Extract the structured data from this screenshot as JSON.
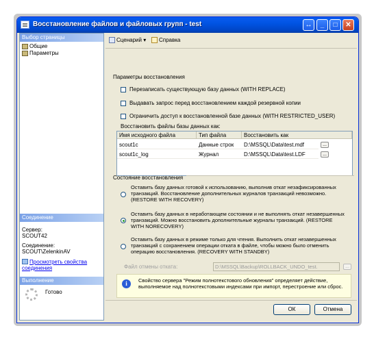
{
  "window": {
    "title": "Восстановление файлов и файловых групп - test"
  },
  "left_panel": {
    "select_page_header": "Выбор страницы",
    "pages": [
      {
        "label": "Общие"
      },
      {
        "label": "Параметры"
      }
    ],
    "connection_header": "Соединение",
    "server_label": "Сервер:",
    "server_value": "SCOUT42",
    "connection_label": "Соединение:",
    "connection_value": "SCOUT\\ZelenkinAV",
    "view_properties_link": "Просмотреть свойства соединения",
    "progress_header": "Выполнение",
    "progress_status": "Готово"
  },
  "toolbar": {
    "script_label": "Сценарий",
    "help_label": "Справка"
  },
  "restore_options": {
    "title": "Параметры восстановления",
    "checkboxes": [
      {
        "label": "Перезаписать существующую базу данных (WITH REPLACE)",
        "checked": false
      },
      {
        "label": "Выдавать запрос перед восстановлением каждой резервной копии",
        "checked": false
      },
      {
        "label": "Ограничить доступ к восстановленной базе данных (WITH RESTRICTED_USER)",
        "checked": false
      }
    ],
    "files_label": "Восстановить файлы базы данных как:",
    "grid": {
      "columns": [
        "Имя исходного файла",
        "Тип файла",
        "Восстановить как"
      ],
      "rows": [
        {
          "name": "scout1c",
          "type": "Данные строк",
          "restore_as": "D:\\MSSQL\\Data\\test.mdf"
        },
        {
          "name": "scout1c_log",
          "type": "Журнал",
          "restore_as": "D:\\MSSQL\\Data\\test.LDF"
        }
      ]
    }
  },
  "recovery_state": {
    "title": "Состояние восстановления",
    "options": [
      {
        "text": "Оставить базу данных готовой к использованию, выполнив откат незафиксированных транзакций. Восстановление дополнительных журналов транзакций невозможно. (RESTORE WITH RECOVERY)",
        "selected": false
      },
      {
        "text": "Оставить базу данных в неработающем состоянии и не выполнять откат незавершенных транзакций. Можно восстановить дополнительные журналы транзакций. (RESTORE WITH NORECOVERY)",
        "selected": true
      },
      {
        "text": "Оставить базу данных в режиме только для чтения. Выполнить откат незавершенных транзакций с сохранением операции отката в файле, чтобы можно было отменить операцию восстановления. (RECOVERY WITH STANDBY)",
        "selected": false
      }
    ],
    "standby_label": "Файл отмены отката:",
    "standby_value": "D:\\MSSQL\\Backup\\ROLLBACK_UNDO_test."
  },
  "info": {
    "text": "Свойство сервера \"Режим полнотекстового обновления\" определяет действие, выполняемое над полнотекстовыми индексами при импорт, перестроение или сброс."
  },
  "buttons": {
    "ok": "ОК",
    "cancel": "Отмена"
  },
  "colors": {
    "titlebar": "#0054e3",
    "panel": "#ece9d8",
    "section_header": "#7ba2e7",
    "selected_radio": "#2e9e2e"
  }
}
